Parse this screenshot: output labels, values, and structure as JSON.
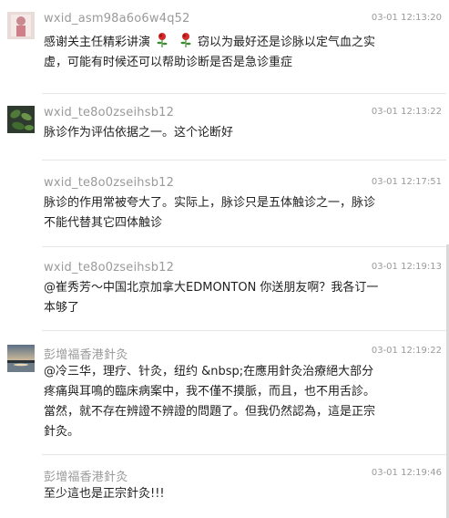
{
  "comments": [
    {
      "username": "wxid_asm98a6o6w4q52",
      "time": "03-01 12:13:20",
      "text_a": "感谢关主任精彩讲演",
      "text_b": "窃以为最好还是诊脉以定气血之实",
      "text_c": "虚，可能有时候还可以帮助诊断是否是急诊重症",
      "avatar_icon": "pink-figure-avatar-icon"
    },
    {
      "username": "wxid_te8o0zseihsb12",
      "time": "03-01 12:13:22",
      "text": "脉诊作为评估依据之一。这个论断好",
      "avatar_icon": "green-leaves-avatar-icon"
    },
    {
      "username": "wxid_te8o0zseihsb12",
      "time": "03-01 12:17:51",
      "text_line1": "脉诊的作用常被夸大了。实际上，脉诊只是五体触诊之一，脉诊",
      "text_line2": "不能代替其它四体触诊"
    },
    {
      "username": "wxid_te8o0zseihsb12",
      "time": "03-01 12:19:13",
      "text_line1": "@崔秀芳～中国北京加拿大EDMONTON 你送朋友啊？我各订一",
      "text_line2": "本够了"
    },
    {
      "username": "彭增福香港針灸",
      "time": "03-01 12:19:22",
      "text_line1": "@冷三华，理疗、针灸，纽约 &nbsp;在應用針灸治療絕大部分",
      "text_line2": "疼痛與耳鳴的臨床病案中，我不僅不摸脈，而且，也不用舌診。",
      "text_line3": "當然，就不存在辨證不辨證的問題了。但我仍然認為，這是正宗",
      "text_line4": "針灸。",
      "avatar_icon": "sunset-lake-avatar-icon"
    },
    {
      "username": "彭增福香港針灸",
      "time": "03-01 12:19:46",
      "text": "至少這也是正宗針灸!!!"
    }
  ],
  "colors": {
    "username": "#9a9a9a",
    "text": "#222222",
    "separator": "#e6e6e6"
  }
}
